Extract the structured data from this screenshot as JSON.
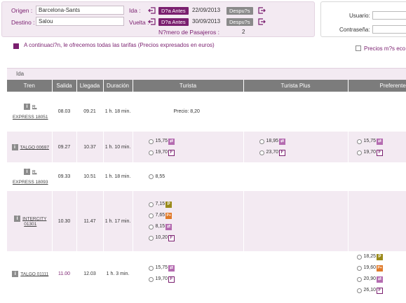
{
  "search": {
    "origen_label": "Origen :",
    "origen_value": "Barcelona-Sants",
    "destino_label": "Destino :",
    "destino_value": "Salou",
    "ida_label": "Ida :",
    "vuelta_label": "Vuelta :",
    "ida_date": "22/09/2013",
    "vuelta_date": "30/09/2013",
    "prev_label": "D?a Antes",
    "next_label": "Despu?s",
    "pasajeros_label": "N?mero de Pasajeros :",
    "pasajeros_value": "2"
  },
  "login": {
    "usuario_label": "Usuario:",
    "password_label": "Contraseña:"
  },
  "info_text": "A continuaci?n, le ofrecemos todas las tarifas (Precios expresados en euros)",
  "precios_label": "Precios m?s eco",
  "ida_section_label": "Ida",
  "columns": [
    "Tren",
    "Salida",
    "Llegada",
    "Duración",
    "Turista",
    "Turista Plus",
    "Preferente"
  ],
  "rows": [
    {
      "tren_prefix": "R.",
      "tren": "EXPRESS 18051",
      "salida": "08.03",
      "llegada": "09.21",
      "duracion": "1 h. 18 min.",
      "turista_plain": "Precio: 8,20",
      "turista": [],
      "turista_plus": [],
      "preferente": []
    },
    {
      "tren_prefix": "",
      "tren": "TALGO 00697",
      "salida": "09.27",
      "llegada": "10.37",
      "duracion": "1 h. 10 min.",
      "turista_plain": "",
      "turista": [
        {
          "value": "15,75",
          "badge": "swap"
        },
        {
          "value": "19,70",
          "badge": "F"
        }
      ],
      "turista_plus": [
        {
          "value": "18,95",
          "badge": "swap"
        },
        {
          "value": "23,70",
          "badge": "F"
        }
      ],
      "preferente": [
        {
          "value": "15,75",
          "badge": "swap"
        },
        {
          "value": "19,70",
          "badge": "F"
        }
      ]
    },
    {
      "tren_prefix": "R.",
      "tren": "EXPRESS 18093",
      "salida": "09.33",
      "llegada": "10.51",
      "duracion": "1 h. 18 min.",
      "turista_plain": "",
      "turista": [
        {
          "value": "8,55",
          "badge": ""
        }
      ],
      "turista_plus": [],
      "preferente": []
    },
    {
      "tren_prefix": "",
      "tren": "INTERCITY 01301",
      "salida": "10.30",
      "llegada": "11.47",
      "duracion": "1 h. 17 min.",
      "turista_plain": "",
      "turista": [
        {
          "value": "7,15",
          "badge": "P"
        },
        {
          "value": "7,65",
          "badge": "P+"
        },
        {
          "value": "8,15",
          "badge": "swap"
        },
        {
          "value": "10,20",
          "badge": "F"
        }
      ],
      "turista_plus": [],
      "preferente": []
    },
    {
      "tren_prefix": "",
      "tren": "TALGO 01111",
      "salida": "11.00",
      "llegada": "12.03",
      "duracion": "1 h. 3 min.",
      "turista_plain": "",
      "turista": [
        {
          "value": "15,75",
          "badge": "swap"
        },
        {
          "value": "19,70",
          "badge": "F"
        }
      ],
      "turista_plus": [],
      "preferente": [
        {
          "value": "18,25",
          "badge": "P"
        },
        {
          "value": "19,60",
          "badge": "P+"
        },
        {
          "value": "20,90",
          "badge": "swap"
        },
        {
          "value": "26,10",
          "badge": "F"
        }
      ]
    }
  ]
}
